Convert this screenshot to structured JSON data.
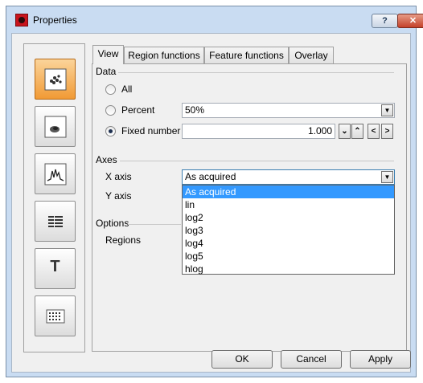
{
  "window": {
    "title": "Properties",
    "help_label": "?",
    "close_label": "✕"
  },
  "sidebar": {
    "items": [
      {
        "name": "dot-plot",
        "icon": "scatter-plot-icon",
        "active": true
      },
      {
        "name": "density-plot",
        "icon": "density-plot-icon",
        "active": false
      },
      {
        "name": "histogram",
        "icon": "histogram-icon",
        "active": false
      },
      {
        "name": "table",
        "icon": "table-icon",
        "active": false
      },
      {
        "name": "text",
        "icon": "text-icon",
        "label": "T",
        "active": false
      },
      {
        "name": "grid",
        "icon": "grid-icon",
        "active": false
      }
    ]
  },
  "tabs": [
    {
      "label": "View",
      "active": true
    },
    {
      "label": "Region functions",
      "active": false
    },
    {
      "label": "Feature functions",
      "active": false
    },
    {
      "label": "Overlay",
      "active": false
    }
  ],
  "data_group": {
    "label": "Data",
    "options": {
      "all": "All",
      "percent": "Percent",
      "fixed": "Fixed number"
    },
    "selected": "fixed",
    "percent_value": "50%",
    "fixed_value": "1.000"
  },
  "axes_group": {
    "label": "Axes",
    "x_label": "X axis",
    "x_value": "As acquired",
    "y_label": "Y axis",
    "dropdown_options": [
      "As acquired",
      "lin",
      "log2",
      "log3",
      "log4",
      "log5",
      "hlog"
    ],
    "dropdown_selected": 0
  },
  "options_group": {
    "label": "Options",
    "regions_label": "Regions"
  },
  "buttons": {
    "ok": "OK",
    "cancel": "Cancel",
    "apply": "Apply"
  },
  "icons": {
    "spin_down": "⌄",
    "spin_up": "⌃",
    "spin_left": "<",
    "spin_right": ">",
    "combo": "▼"
  },
  "colors": {
    "active_sidebar": "#f19a35",
    "selection": "#3399ff",
    "close_button": "#c4412a"
  }
}
